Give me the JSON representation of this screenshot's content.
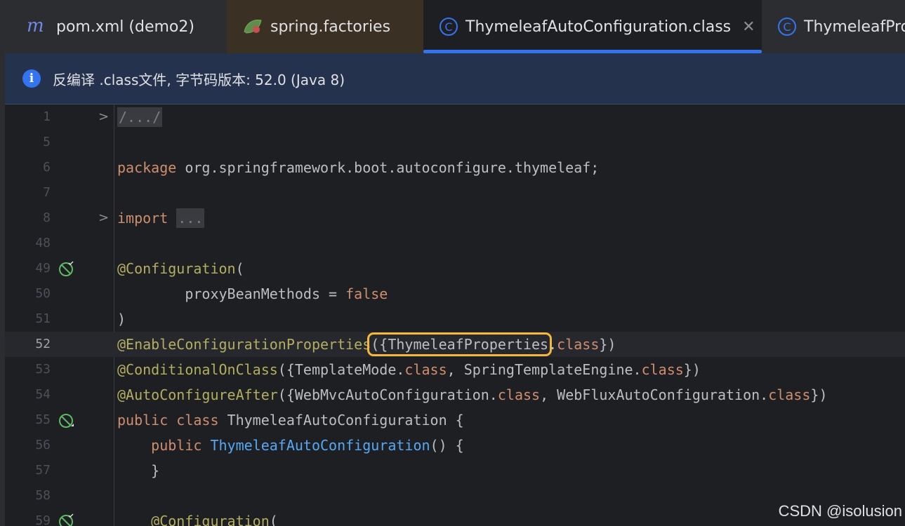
{
  "tabs": [
    {
      "label": "pom.xml (demo2)",
      "icon": "maven-icon"
    },
    {
      "label": "spring.factories",
      "icon": "spring-icon"
    },
    {
      "label": "ThymeleafAutoConfiguration.class",
      "icon": "class-icon",
      "active": true
    },
    {
      "label": "ThymeleafPro",
      "icon": "class-icon"
    }
  ],
  "banner": {
    "icon": "info-icon",
    "text": "反编译 .class文件, 字节码版本: 52.0 (Java 8)"
  },
  "editor": {
    "current_line": "52",
    "lines": [
      {
        "n": "1",
        "parts": [
          "/.../"
        ]
      },
      {
        "n": "5",
        "parts": [
          ""
        ]
      },
      {
        "n": "6",
        "parts": [
          "package",
          " org.springframework.boot.autoconfigure.thymeleaf;"
        ]
      },
      {
        "n": "7",
        "parts": [
          ""
        ]
      },
      {
        "n": "8",
        "parts": [
          "import",
          " ",
          "..."
        ]
      },
      {
        "n": "48",
        "parts": [
          ""
        ]
      },
      {
        "n": "49",
        "parts": [
          "@Configuration",
          "("
        ]
      },
      {
        "n": "50",
        "parts": [
          "        proxyBeanMethods = ",
          "false"
        ]
      },
      {
        "n": "51",
        "parts": [
          ")"
        ]
      },
      {
        "n": "52",
        "parts": [
          "@EnableConfigurationProperties",
          "(",
          "{ThymeleafProperties",
          ".",
          "class",
          "})"
        ]
      },
      {
        "n": "53",
        "parts": [
          "@ConditionalOnClass",
          "({TemplateMode.",
          "class",
          ", SpringTemplateEngine.",
          "class",
          "})"
        ]
      },
      {
        "n": "54",
        "parts": [
          "@AutoConfigureAfter",
          "({WebMvcAutoConfiguration.",
          "class",
          ", WebFluxAutoConfiguration.",
          "class",
          "})"
        ]
      },
      {
        "n": "55",
        "parts": [
          "public",
          " ",
          "class",
          " ThymeleafAutoConfiguration {"
        ]
      },
      {
        "n": "56",
        "parts": [
          "    ",
          "public",
          " ",
          "ThymeleafAutoConfiguration",
          "() {"
        ]
      },
      {
        "n": "57",
        "parts": [
          "    }"
        ]
      },
      {
        "n": "58",
        "parts": [
          ""
        ]
      },
      {
        "n": "59",
        "parts": [
          "    ",
          "@Configuration",
          "("
        ]
      }
    ]
  },
  "watermark": "CSDN @isolusion",
  "colors": {
    "keyword": "#cf8e6d",
    "annotation": "#b3ae60",
    "method": "#56a8f5",
    "highlight": "#f5b83d",
    "accent": "#3574f0"
  }
}
